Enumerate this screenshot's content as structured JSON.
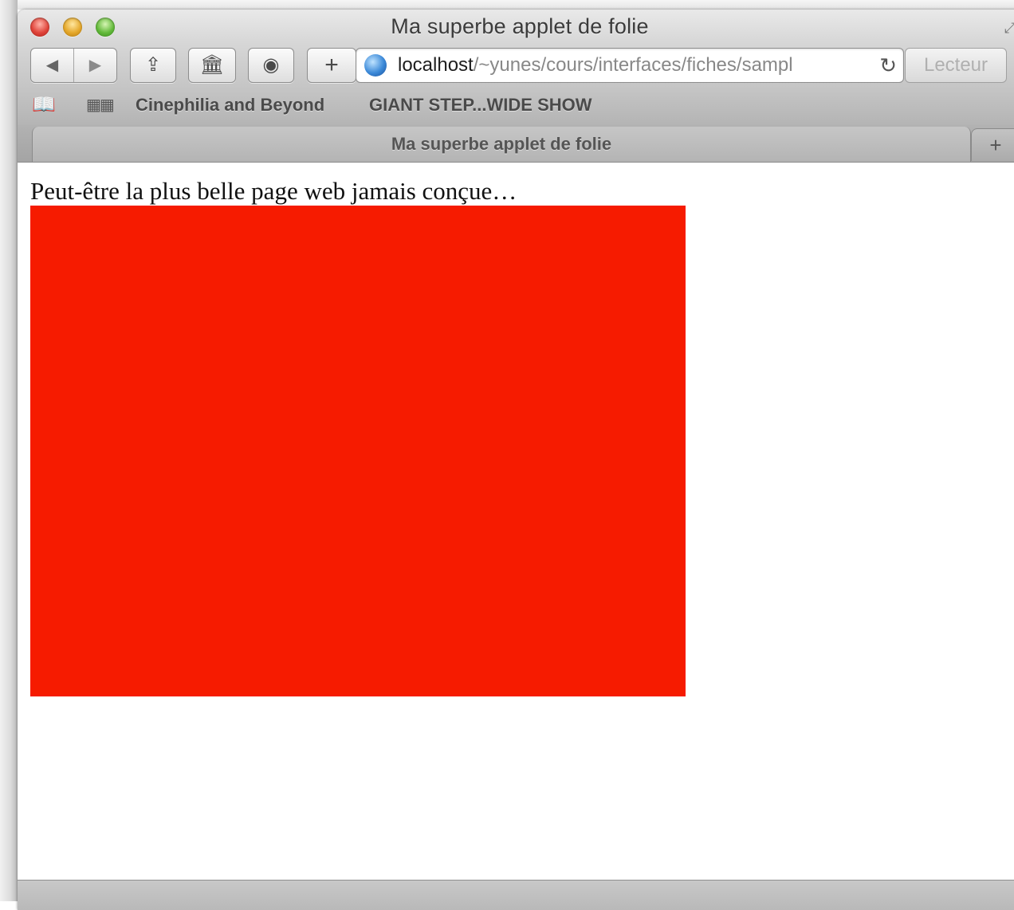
{
  "window": {
    "title": "Ma superbe applet de folie"
  },
  "toolbar": {
    "back_icon": "◀",
    "forward_icon": "▶",
    "share_icon": "⇪",
    "history_icon": "🏛",
    "ghostery_icon": "◉",
    "add_icon": "+",
    "address_host": "localhost",
    "address_path": "/~yunes/cours/interfaces/fiches/sampl",
    "reload_icon": "↻",
    "reader_label": "Lecteur"
  },
  "bookmarks": {
    "book_icon": "📖",
    "grid_icon": "▦▦",
    "items": [
      "Cinephilia and Beyond",
      "GIANT STEP...WIDE SHOW"
    ]
  },
  "tabs": {
    "active_label": "Ma superbe applet de folie",
    "new_tab_icon": "+"
  },
  "page": {
    "headline": "Peut-être la plus belle page web jamais conçue…",
    "box_color": "#f61b00"
  }
}
